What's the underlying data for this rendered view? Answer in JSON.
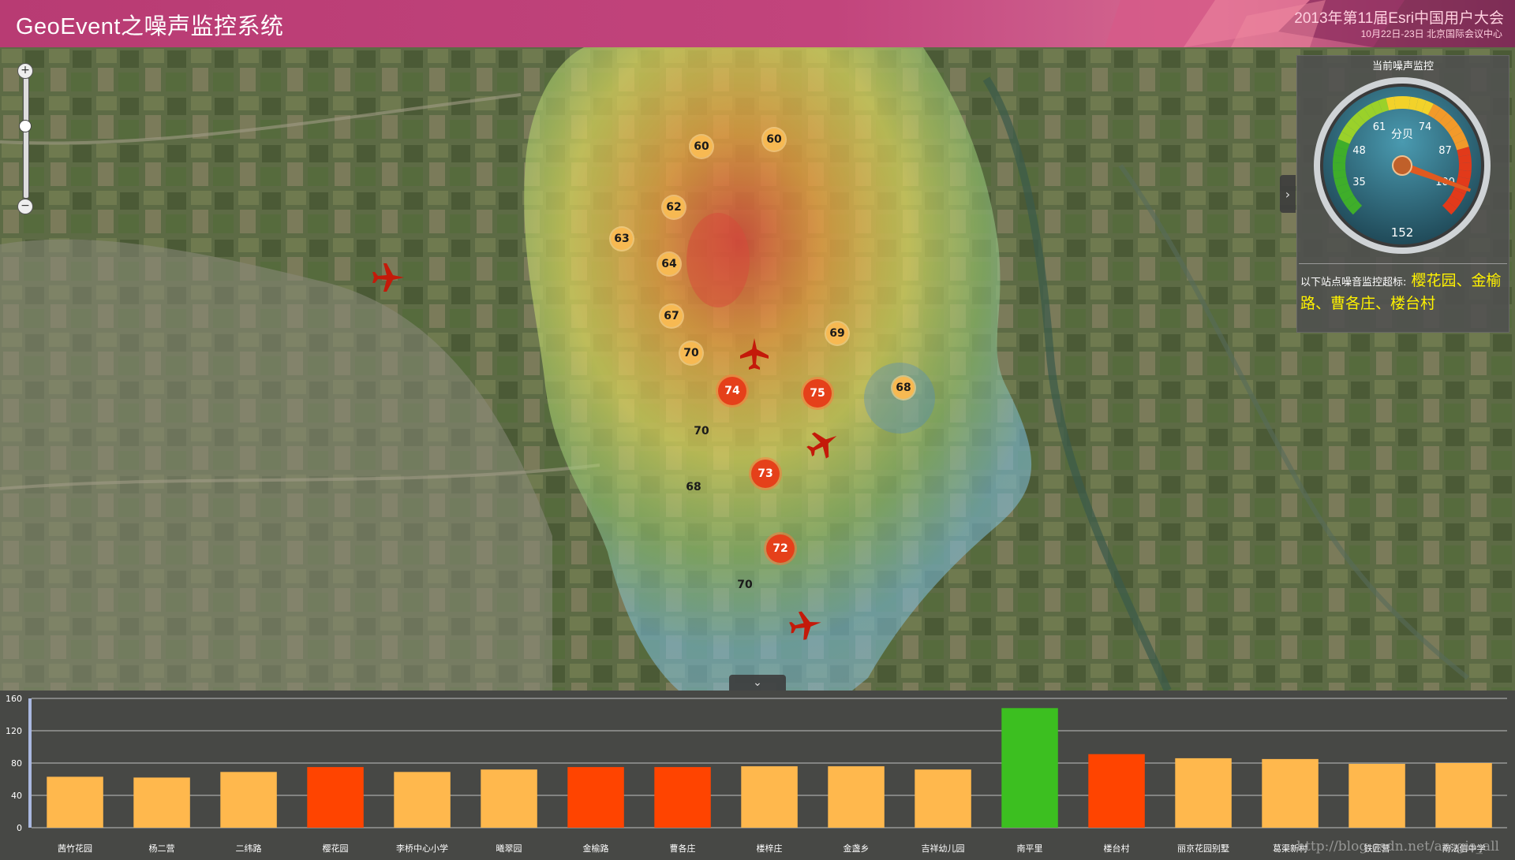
{
  "header": {
    "title": "GeoEvent之噪声监控系统",
    "conference": "2013年第11届Esri中国用户大会",
    "conference_sub": "10月22日-23日 北京国际会议中心"
  },
  "map": {
    "stations": [
      {
        "value": "60",
        "style": "normal"
      },
      {
        "value": "60",
        "style": "normal"
      },
      {
        "value": "62",
        "style": "normal"
      },
      {
        "value": "63",
        "style": "normal"
      },
      {
        "value": "64",
        "style": "normal"
      },
      {
        "value": "67",
        "style": "normal"
      },
      {
        "value": "69",
        "style": "normal"
      },
      {
        "value": "70",
        "style": "normal"
      },
      {
        "value": "74",
        "style": "over"
      },
      {
        "value": "75",
        "style": "over"
      },
      {
        "value": "68",
        "style": "normal"
      },
      {
        "value": "70",
        "style": "plain"
      },
      {
        "value": "73",
        "style": "over"
      },
      {
        "value": "68",
        "style": "plain"
      },
      {
        "value": "72",
        "style": "over"
      },
      {
        "value": "70",
        "style": "plain"
      }
    ],
    "zoom": {
      "in_label": "+",
      "out_label": "−"
    },
    "plane_icon": "airplane-icon",
    "heat_colors": [
      "#d84a3a",
      "#f0a040",
      "#e8e060",
      "#9ccd78",
      "#7cc0e0"
    ]
  },
  "gauge_panel": {
    "title": "当前噪声监控",
    "unit": "分贝",
    "ticks": [
      "35",
      "48",
      "61",
      "74",
      "87",
      "100"
    ],
    "current_value": "152",
    "alert_label": "以下站点噪音监控超标:",
    "alert_stations": "樱花园、金榆路、曹各庄、楼台村"
  },
  "chart_data": {
    "type": "bar",
    "ylim": [
      0,
      160
    ],
    "yticks": [
      "0",
      "40",
      "80",
      "120",
      "160"
    ],
    "grid": true,
    "categories": [
      "茜竹花园",
      "杨二营",
      "二纬路",
      "樱花园",
      "李桥中心小学",
      "曦翠园",
      "金榆路",
      "曹各庄",
      "楼梓庄",
      "金盏乡",
      "吉祥幼儿园",
      "南平里",
      "楼台村",
      "丽京花园别墅",
      "葛渠新村",
      "铁匠营",
      "南法信中学"
    ],
    "values": [
      63,
      62,
      69,
      75,
      69,
      72,
      75,
      75,
      76,
      76,
      72,
      148,
      91,
      86,
      85,
      79,
      80
    ],
    "colors": [
      "#ffb84d",
      "#ffb84d",
      "#ffb84d",
      "#ff4400",
      "#ffb84d",
      "#ffb84d",
      "#ff4400",
      "#ff4400",
      "#ffb84d",
      "#ffb84d",
      "#ffb84d",
      "#3cbf20",
      "#ff4400",
      "#ffb84d",
      "#ffb84d",
      "#ffb84d",
      "#ffb84d"
    ]
  },
  "watermark": "http://blog.csdn.net/arcgis_all"
}
